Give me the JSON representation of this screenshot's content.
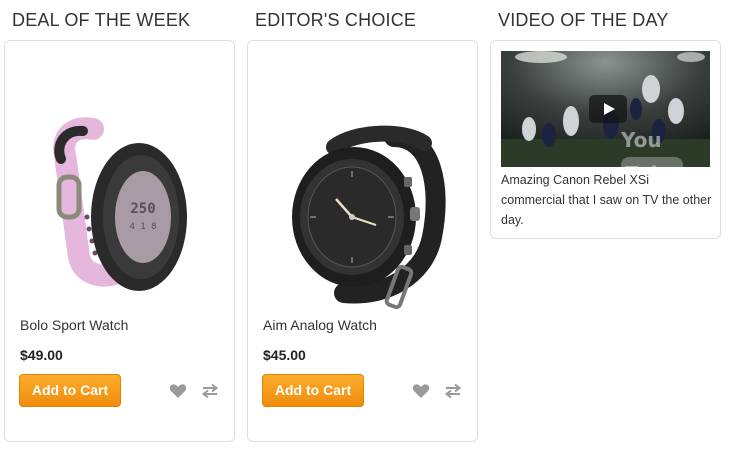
{
  "sections": {
    "deal": {
      "title": "DEAL OF THE WEEK"
    },
    "editor": {
      "title": "EDITOR'S CHOICE"
    },
    "video": {
      "title": "VIDEO OF THE DAY"
    }
  },
  "products": [
    {
      "name": "Bolo Sport Watch",
      "price": "$49.00",
      "add_to_cart": "Add to Cart",
      "strap_color": "#e5b7dd"
    },
    {
      "name": "Aim Analog Watch",
      "price": "$45.00",
      "add_to_cart": "Add to Cart",
      "strap_color": "#2a2a2a"
    }
  ],
  "video": {
    "description": "Amazing Canon Rebel XSi commercial that I saw on TV the other day.",
    "logo_you": "You",
    "logo_tube": "Tube"
  },
  "colors": {
    "accent": "#f7a11f",
    "icon_gray": "#9a9a9a",
    "border": "#dedede"
  },
  "icons": {
    "wishlist": "heart-icon",
    "compare": "compare-arrows-icon",
    "play": "play-icon"
  }
}
